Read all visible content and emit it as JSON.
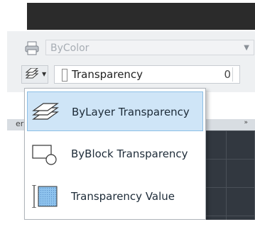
{
  "property_panel": {
    "color_field_value": "ByColor",
    "transparency_field_label": "Transparency",
    "transparency_field_value": "0"
  },
  "dropdown_menu": {
    "items": [
      {
        "label": "ByLayer Transparency",
        "icon": "bylayer-transparency-icon",
        "selected": true
      },
      {
        "label": "ByBlock Transparency",
        "icon": "byblock-transparency-icon",
        "selected": false
      },
      {
        "label": "Transparency Value",
        "icon": "transparency-value-icon",
        "selected": false
      }
    ]
  },
  "side_strip": {
    "text": "er",
    "collapse_glyph": "»"
  },
  "colors": {
    "selection_fill": "#cfe5f7",
    "selection_border": "#8cbfe6",
    "canvas_bg": "#323840"
  }
}
